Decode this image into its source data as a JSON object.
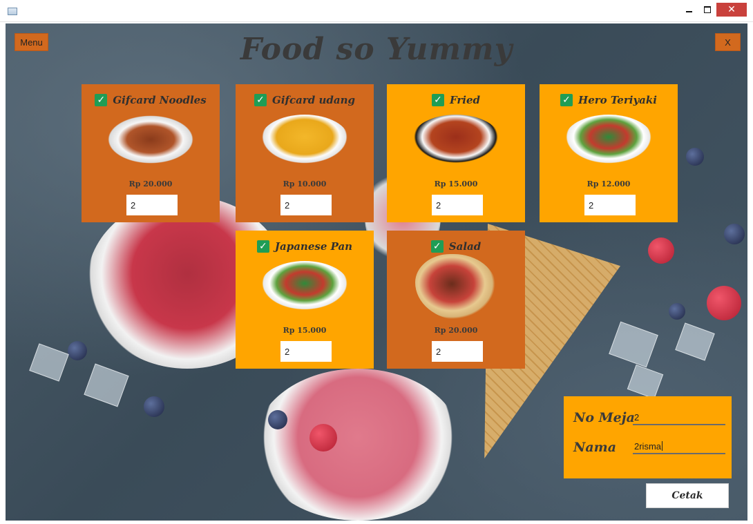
{
  "window": {
    "close_glyph": "✕"
  },
  "app": {
    "title": "Food so Yummy",
    "menu_label": "Menu",
    "close_label": "X"
  },
  "menu_items": [
    {
      "name": "Gifcard Noodles",
      "price": "Rp 20.000",
      "qty": "2",
      "checked": true,
      "icon": "noodle-plate-image"
    },
    {
      "name": "Gifcard udang",
      "price": "Rp 10.000",
      "qty": "2",
      "checked": true,
      "icon": "fries-plate-image"
    },
    {
      "name": "Fried",
      "price": "Rp 15.000",
      "qty": "2",
      "checked": true,
      "icon": "fried-noodle-plate-image"
    },
    {
      "name": "Hero Teriyaki",
      "price": "Rp 12.000",
      "qty": "2",
      "checked": true,
      "icon": "teriyaki-salad-image"
    },
    {
      "name": "Japanese Pan",
      "price": "Rp 15.000",
      "qty": "2",
      "checked": true,
      "icon": "salad-plate-image"
    },
    {
      "name": "Salad",
      "price": "Rp 20.000",
      "qty": "2",
      "checked": true,
      "icon": "kebab-wrap-image"
    }
  ],
  "form": {
    "table_label": "No Meja",
    "table_value": "2",
    "name_label": "Nama",
    "name_value": "2risma"
  },
  "print_label": "Cetak",
  "colors": {
    "card_dark": "#d2691e",
    "card_light": "#ffa500",
    "check_green": "#1f9d55"
  }
}
